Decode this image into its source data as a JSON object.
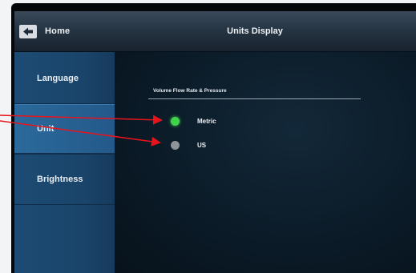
{
  "header": {
    "home_label": "Home",
    "title": "Units Display"
  },
  "sidebar": {
    "items": [
      {
        "label": "Language",
        "active": false
      },
      {
        "label": "Unit",
        "active": true
      },
      {
        "label": "Brightness",
        "active": false
      }
    ]
  },
  "content": {
    "section_title": "Volume Flow Rate & Pressure",
    "options": [
      {
        "label": "Metric",
        "selected": true
      },
      {
        "label": "US",
        "selected": false
      }
    ]
  },
  "colors": {
    "selected": "#3fd34c",
    "unselected": "#8c9399",
    "annotation_arrow": "#e8141c",
    "sidebar": "#1c4b73"
  },
  "icons": {
    "home": "home-icon"
  }
}
